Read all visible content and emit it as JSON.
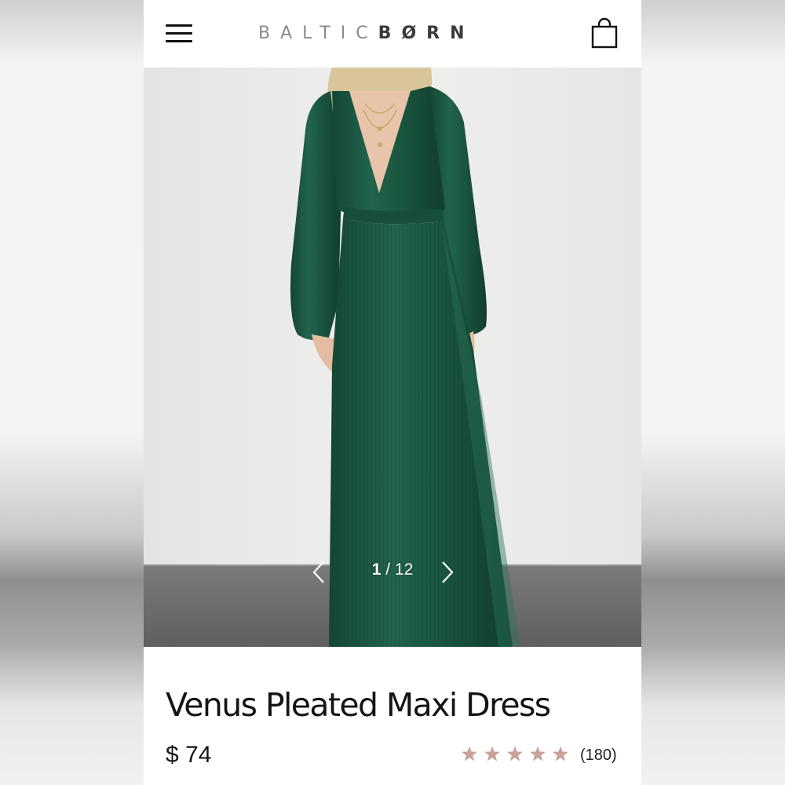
{
  "header": {
    "menu_icon": "hamburger-menu-icon",
    "brand_light": "BALTIC",
    "brand_dark": "BØRN",
    "cart_icon": "shopping-bag-icon"
  },
  "gallery": {
    "current": "1",
    "separator": " / ",
    "total": "12",
    "prev_icon": "chevron-left-icon",
    "next_icon": "chevron-right-icon"
  },
  "product": {
    "title": "Venus Pleated Maxi Dress",
    "price": "$ 74",
    "rating": 5,
    "rating_max": 5,
    "review_count": "(180)"
  },
  "colors": {
    "dress": "#1d5a45",
    "star": "#c9a39a",
    "wall": "#ececea",
    "floor": "#6f6f6d"
  }
}
